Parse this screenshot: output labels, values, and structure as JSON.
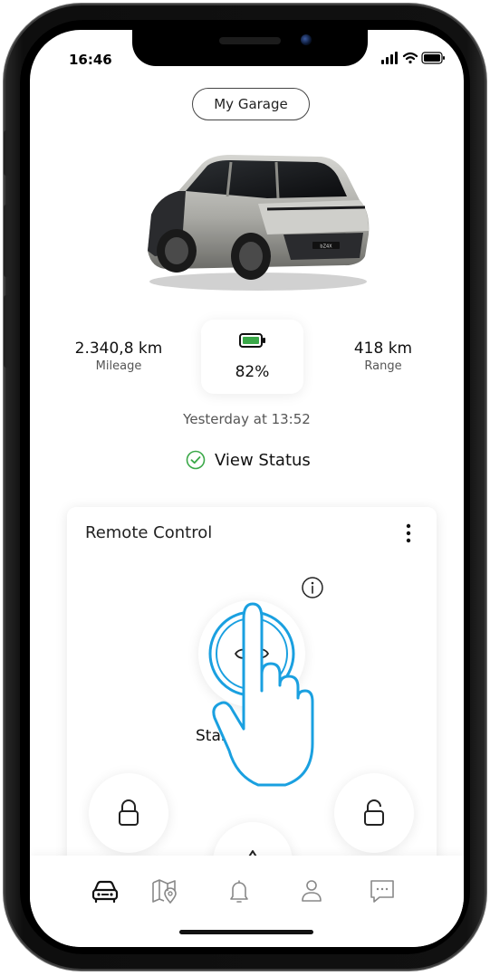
{
  "status_bar": {
    "time": "16:46"
  },
  "header": {
    "garage_button": "My Garage"
  },
  "vehicle": {
    "mileage_value": "2.340,8 km",
    "mileage_label": "Mileage",
    "battery_percent": "82%",
    "range_value": "418 km",
    "range_label": "Range",
    "last_updated": "Yesterday at 13:52",
    "view_status": "View Status"
  },
  "remote_control": {
    "title": "Remote Control",
    "start_label": "Start Climate"
  },
  "tabs": [
    "vehicle",
    "map",
    "notifications",
    "profile",
    "messages"
  ],
  "colors": {
    "accent_blue": "#1aa0e0",
    "battery_green": "#3aa848",
    "status_green": "#3aa848"
  }
}
